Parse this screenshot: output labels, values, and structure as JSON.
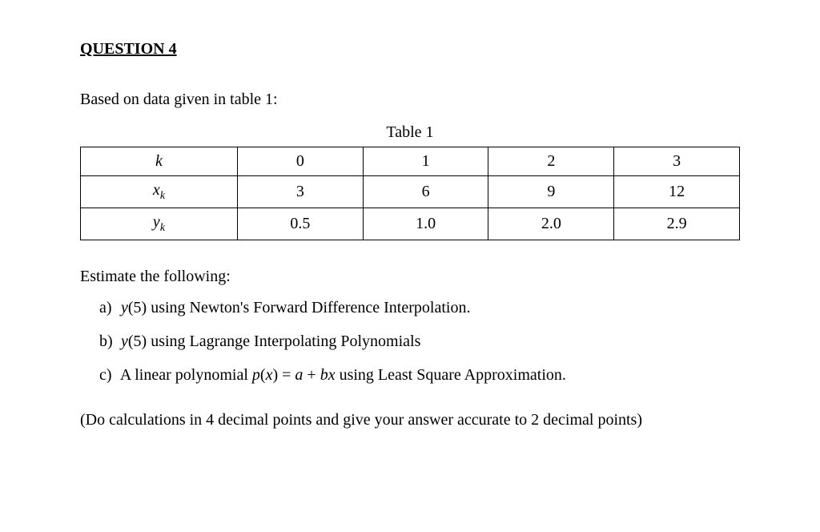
{
  "title": "QUESTION 4",
  "intro": "Based on data given in table 1:",
  "table_caption": "Table 1",
  "table": {
    "rows": [
      {
        "label_html": "<span class='italic'>k</span>",
        "c0": "0",
        "c1": "1",
        "c2": "2",
        "c3": "3"
      },
      {
        "label_html": "<span class='italic'>x</span><span class='sub'>k</span>",
        "c0": "3",
        "c1": "6",
        "c2": "9",
        "c3": "12"
      },
      {
        "label_html": "<span class='italic'>y</span><span class='sub'>k</span>",
        "c0": "0.5",
        "c1": "1.0",
        "c2": "2.0",
        "c3": "2.9"
      }
    ]
  },
  "estimate": "Estimate the following:",
  "items": {
    "a": {
      "label": "a)",
      "text_html": "<span class='italic'>y</span>(5)  using Newton's Forward Difference Interpolation."
    },
    "b": {
      "label": "b)",
      "text_html": "<span class='italic'>y</span>(5) using Lagrange Interpolating Polynomials"
    },
    "c": {
      "label": "c)",
      "text_html": "A linear polynomial <span class='italic'>p</span>(<span class='italic'>x</span>) = <span class='italic'>a</span> + <span class='italic'>bx</span>  using Least Square Approximation."
    }
  },
  "note": "(Do calculations in 4 decimal points and give your answer accurate to 2 decimal points)"
}
